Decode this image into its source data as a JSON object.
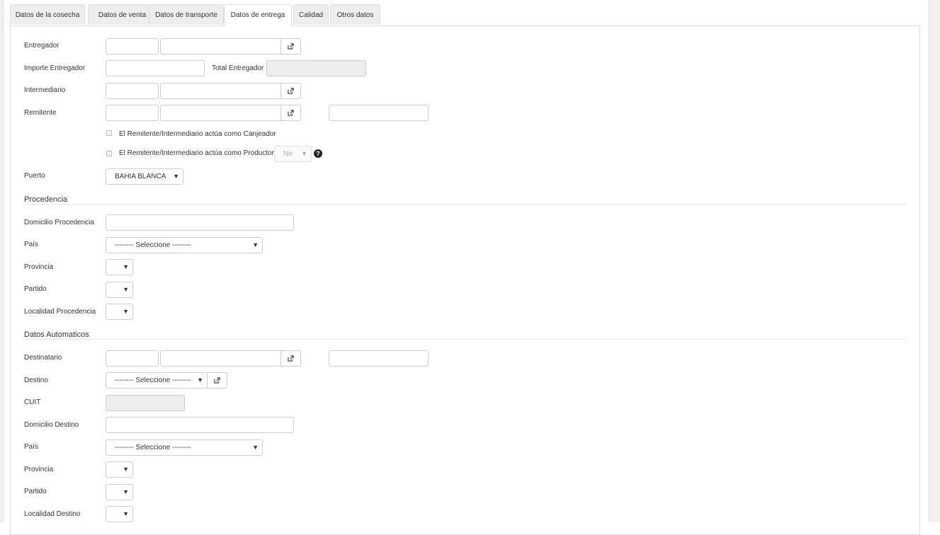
{
  "tabs": [
    {
      "label": "Datos de la cosecha"
    },
    {
      "label": "Datos de venta"
    },
    {
      "label": "Datos de transporte"
    },
    {
      "label": "Datos de entrega"
    },
    {
      "label": "Calidad"
    },
    {
      "label": "Otros datos"
    }
  ],
  "active_tab": "Datos de entrega",
  "form": {
    "entregador": {
      "label": "Entregador",
      "code": "",
      "name": ""
    },
    "importe_entregador": {
      "label": "Importe Entregador",
      "value": ""
    },
    "total_entregador": {
      "label": "Total Entregador",
      "value": ""
    },
    "intermediario": {
      "label": "Intermediario",
      "code": "",
      "name": ""
    },
    "remitente": {
      "label": "Remitente",
      "code": "",
      "name": "",
      "extra": ""
    },
    "canjeador_check": {
      "label": "El Remitente/Intermediario actúa como Canjeador",
      "checked": false
    },
    "productor_check": {
      "label": "El Remitente/Intermediario actúa como Productor",
      "checked": false,
      "select_value": "No"
    },
    "puerto": {
      "label": "Puerto",
      "value": "BAHIA BLANCA"
    }
  },
  "procedencia": {
    "title": "Procedencia",
    "domicilio": {
      "label": "Domicilio Procedencia",
      "value": ""
    },
    "pais": {
      "label": "País",
      "value": "-------- Seleccione --------"
    },
    "provincia": {
      "label": "Provincia",
      "value": ""
    },
    "partido": {
      "label": "Partido",
      "value": ""
    },
    "localidad": {
      "label": "Localidad Procedencia",
      "value": ""
    }
  },
  "automaticos": {
    "title": "Datos Automaticos",
    "destinatario": {
      "label": "Destinatario",
      "code": "",
      "name": "",
      "extra": ""
    },
    "destino": {
      "label": "Destino",
      "value": "-------- Seleccione --------"
    },
    "cuit": {
      "label": "CUIT",
      "value": ""
    },
    "domicilio": {
      "label": "Domicilio Destino",
      "value": ""
    },
    "pais": {
      "label": "País",
      "value": "-------- Seleccione --------"
    },
    "provincia": {
      "label": "Provincia",
      "value": ""
    },
    "partido": {
      "label": "Partido",
      "value": ""
    },
    "localidad": {
      "label": "Localidad Destino",
      "value": ""
    }
  },
  "icons": {
    "open": "external-link-icon",
    "help": "question-circle-icon",
    "caret": "caret-down-icon"
  },
  "colors": {
    "border": "#cccccc",
    "disabled_bg": "#eeeeee",
    "tab_bg": "#eeeeee"
  }
}
